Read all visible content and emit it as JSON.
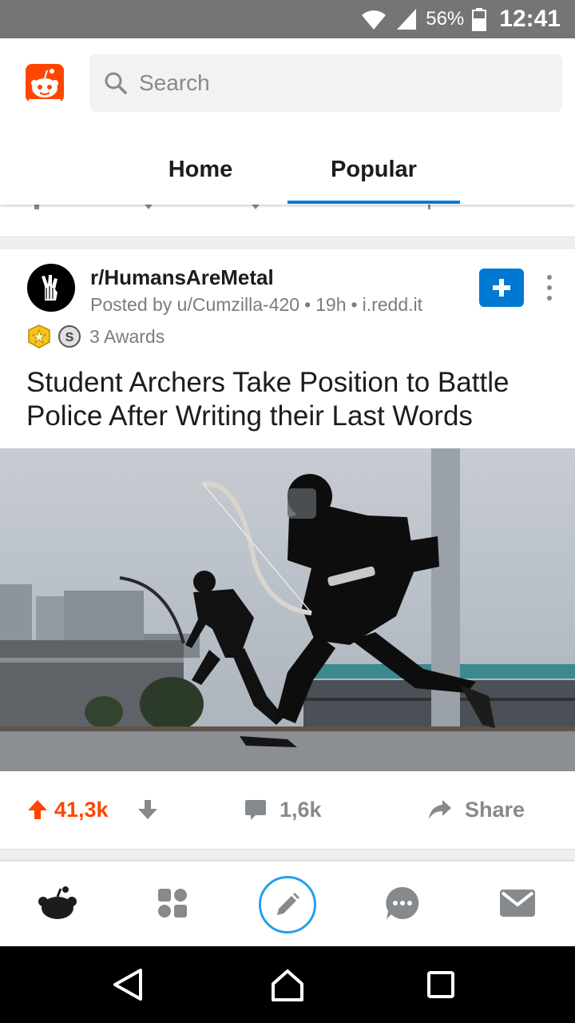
{
  "status_bar": {
    "battery_percent": "56%",
    "time": "12:41"
  },
  "header": {
    "search": {
      "placeholder": "Search"
    },
    "tabs": [
      {
        "label": "Home",
        "selected": false
      },
      {
        "label": "Popular",
        "selected": true
      }
    ]
  },
  "post": {
    "subreddit": "r/HumansAreMetal",
    "posted_by": "Posted by u/Cumzilla-420",
    "age": "19h",
    "domain": "i.redd.it",
    "awards_label": "3 Awards",
    "title": "Student Archers Take Position to Battle Police After Writing their Last Words",
    "score": "41,3k",
    "comments": "1,6k",
    "share_label": "Share"
  },
  "bottom_nav": {
    "items": [
      "home-icon",
      "communities-icon",
      "create-post-icon",
      "chat-icon",
      "inbox-icon"
    ]
  },
  "colors": {
    "accent_orange": "#ff4500",
    "accent_blue": "#0079d3",
    "create_ring": "#24a0ed",
    "muted_text": "#878a8c"
  }
}
